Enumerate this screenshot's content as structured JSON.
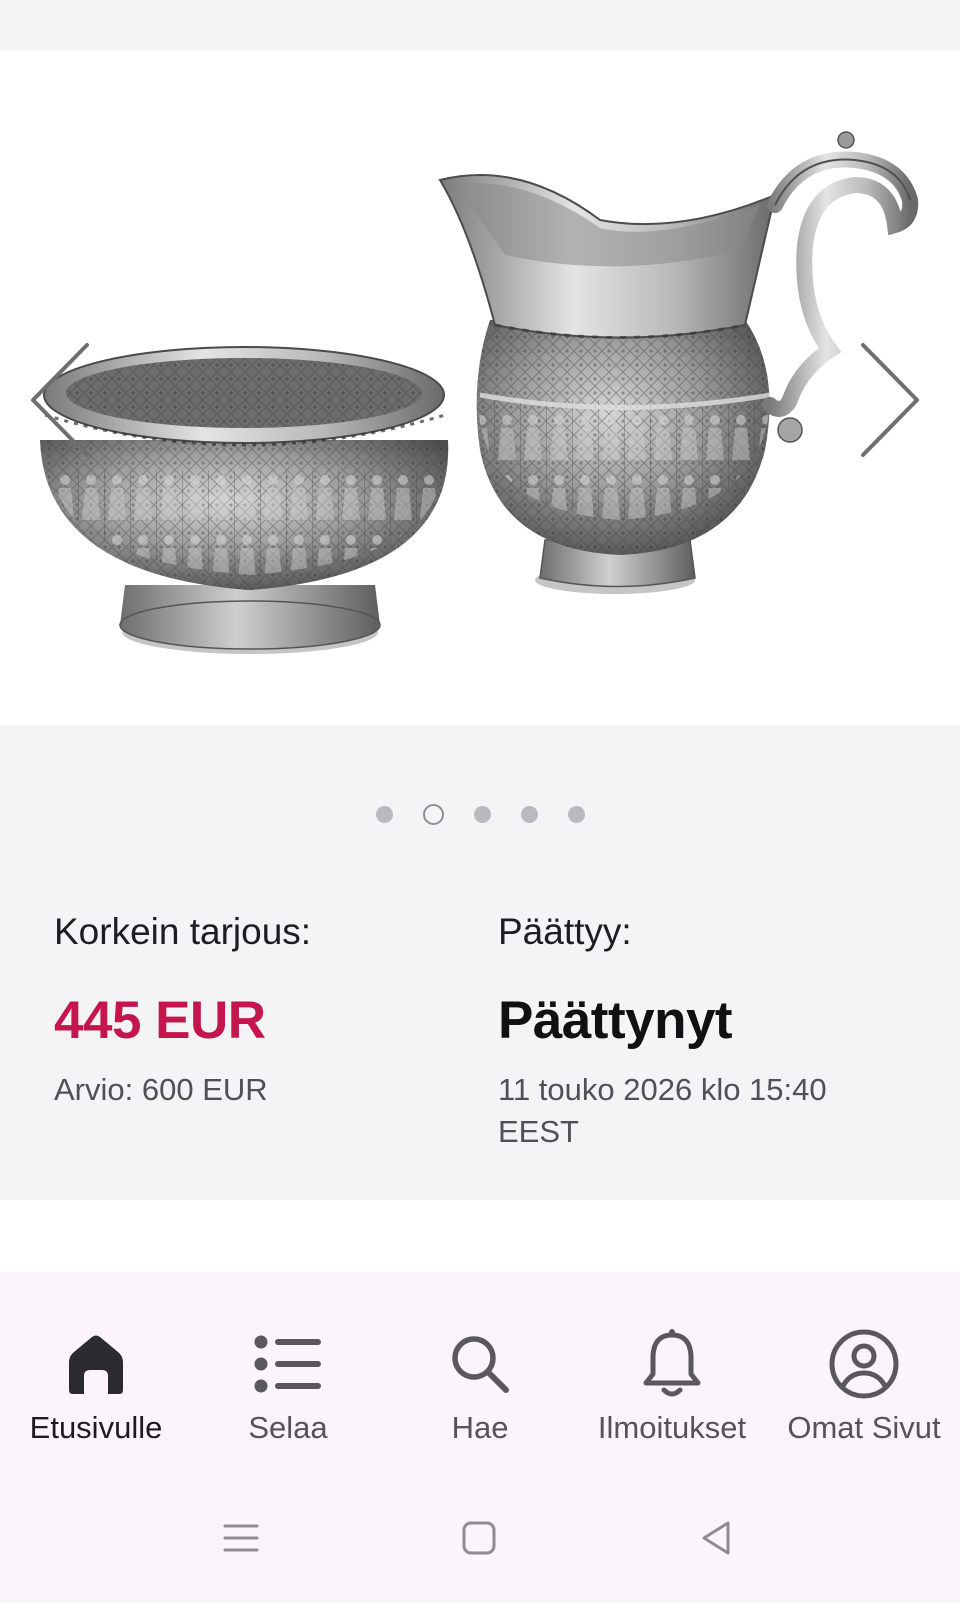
{
  "carousel": {
    "slide_count": 5,
    "active_slide": 2
  },
  "auction": {
    "bid_label": "Korkein tarjous:",
    "bid_value": "445 EUR",
    "estimate": "Arvio: 600 EUR",
    "ends_label": "Päättyy:",
    "status": "Päättynyt",
    "end_date_line1": "11 touko 2026 klo 15:40",
    "end_date_line2": "EEST"
  },
  "tabs": [
    {
      "label": "Etusivulle",
      "icon": "home-icon",
      "active": true
    },
    {
      "label": "Selaa",
      "icon": "list-icon",
      "active": false
    },
    {
      "label": "Hae",
      "icon": "search-icon",
      "active": false
    },
    {
      "label": "Ilmoitukset",
      "icon": "bell-icon",
      "active": false
    },
    {
      "label": "Omat Sivut",
      "icon": "account-icon",
      "active": false
    }
  ],
  "colors": {
    "price": "#c4164d",
    "tabbar_bg": "#fbf4fa",
    "page_bg": "#f4f4f7"
  }
}
